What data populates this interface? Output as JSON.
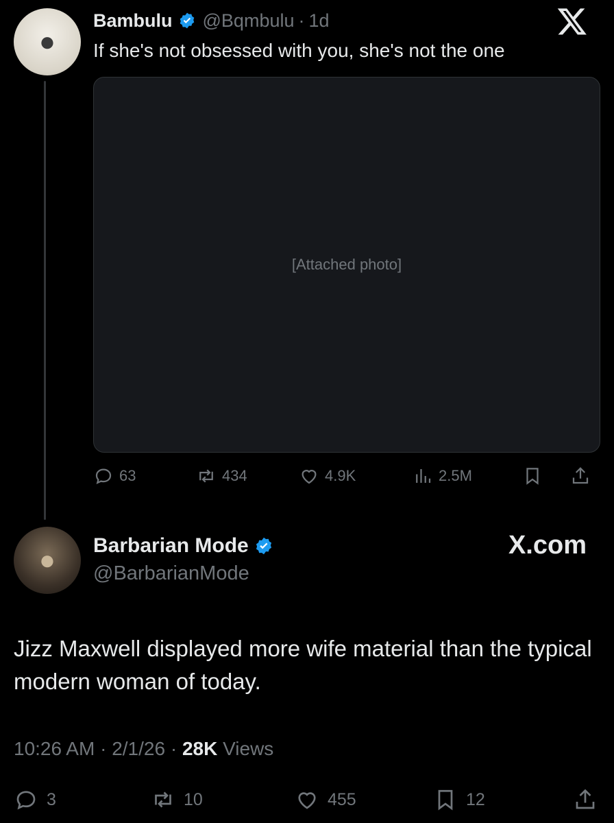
{
  "tweet1": {
    "display_name": "Bambulu",
    "handle": "@Bqmbulu",
    "age": "1d",
    "text": "If she's not obsessed with you, she's not the one",
    "media_alt": "[Attached photo]",
    "stats": {
      "replies": "63",
      "reposts": "434",
      "likes": "4.9K",
      "views": "2.5M"
    }
  },
  "tweet2": {
    "display_name": "Barbarian Mode",
    "handle": "@BarbarianMode",
    "text": "Jizz Maxwell displayed more wife material than the typical modern woman of today.",
    "time": "10:26 AM",
    "date": "2/1/26",
    "views_count": "28K",
    "views_label": "Views",
    "stats": {
      "replies": "3",
      "reposts": "10",
      "likes": "455",
      "bookmarks": "12"
    }
  },
  "brand": {
    "watermark": "X.com"
  },
  "icons": {
    "verified": "verified-badge-icon",
    "x_logo": "x-logo-icon",
    "reply": "reply-icon",
    "repost": "repost-icon",
    "like": "heart-icon",
    "views": "views-chart-icon",
    "bookmark": "bookmark-icon",
    "share": "share-icon"
  },
  "colors": {
    "background": "#000000",
    "text": "#e7e9ea",
    "muted": "#71767b",
    "verified": "#1d9bf0"
  }
}
